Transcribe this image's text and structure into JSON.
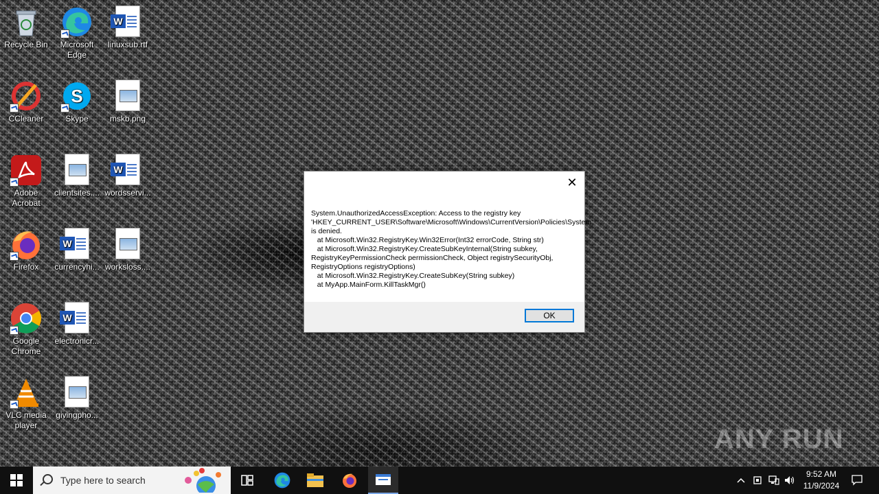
{
  "desktop_icons": [
    {
      "label": "Recycle Bin"
    },
    {
      "label": "Microsoft Edge"
    },
    {
      "label": "linuxsub.rtf"
    },
    {
      "label": "CCleaner"
    },
    {
      "label": "Skype"
    },
    {
      "label": "mskb.png"
    },
    {
      "label": "Adobe Acrobat"
    },
    {
      "label": "clientsites...."
    },
    {
      "label": "wordsservi..."
    },
    {
      "label": "Firefox"
    },
    {
      "label": "currencyhi..."
    },
    {
      "label": "worksloss...."
    },
    {
      "label": "Google Chrome"
    },
    {
      "label": "electronicr..."
    },
    {
      "label": "VLC media player"
    },
    {
      "label": "givingpho..."
    }
  ],
  "dialog": {
    "message": "System.UnauthorizedAccessException: Access to the registry key 'HKEY_CURRENT_USER\\Software\\Microsoft\\Windows\\CurrentVersion\\Policies\\System' is denied.\n   at Microsoft.Win32.RegistryKey.Win32Error(Int32 errorCode, String str)\n   at Microsoft.Win32.RegistryKey.CreateSubKeyInternal(String subkey, RegistryKeyPermissionCheck permissionCheck, Object registrySecurityObj, RegistryOptions registryOptions)\n   at Microsoft.Win32.RegistryKey.CreateSubKey(String subkey)\n   at MyApp.MainForm.KillTaskMgr()",
    "ok_label": "OK",
    "close_glyph": "✕"
  },
  "taskbar": {
    "search_placeholder": "Type here to search",
    "time": "9:52 AM",
    "date": "11/9/2024"
  },
  "watermark": "ANY RUN",
  "colors": {
    "taskbar": "#101010",
    "accent": "#0078d7"
  }
}
